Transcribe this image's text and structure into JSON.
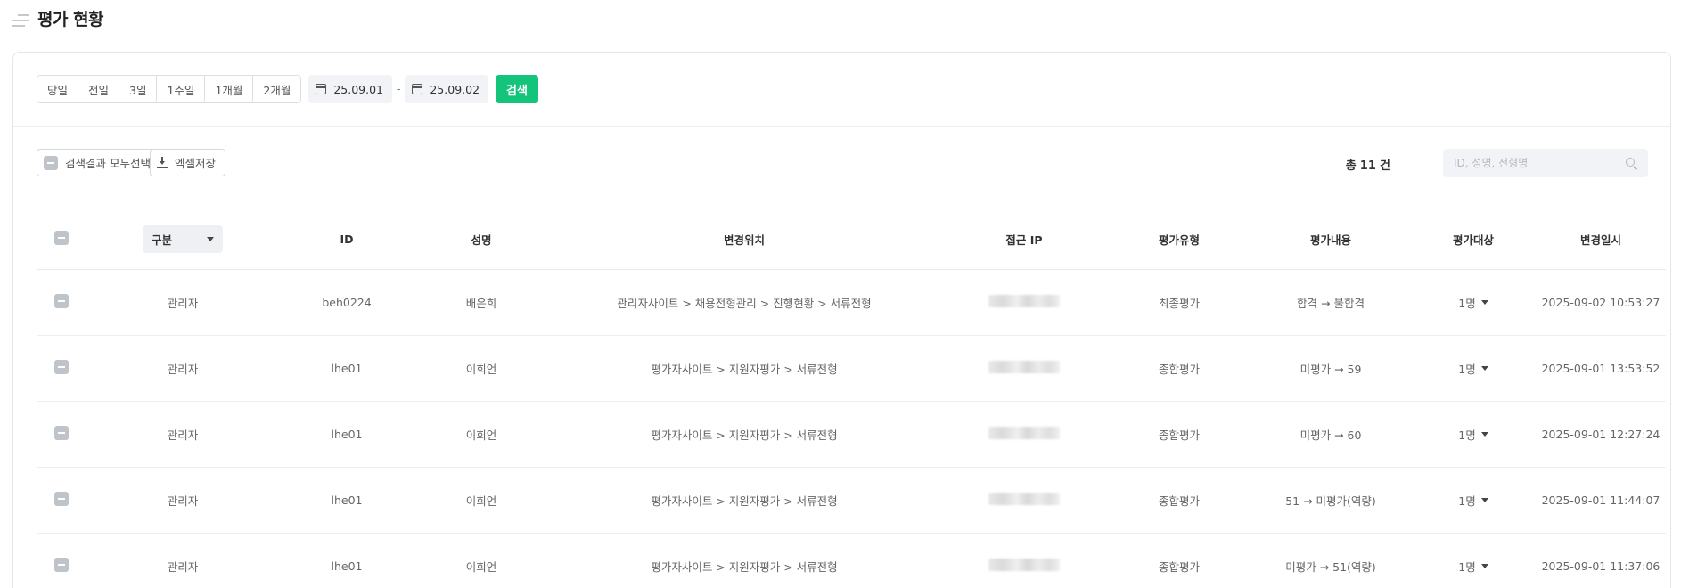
{
  "header": {
    "title": "평가 현황"
  },
  "filters": {
    "periods": [
      "당일",
      "전일",
      "3일",
      "1주일",
      "1개월",
      "2개월"
    ],
    "date_from": "25.09.01",
    "date_separator": "-",
    "date_to": "25.09.02",
    "search_label": "검색"
  },
  "toolbar": {
    "select_all_label": "검색결과 모두선택",
    "excel_label": "엑셀저장",
    "total_prefix": "총",
    "total_count": "11",
    "total_suffix": "건",
    "search_placeholder": "ID, 성명, 전형명"
  },
  "table": {
    "headers": {
      "type": "구분",
      "id": "ID",
      "name": "성명",
      "location": "변경위치",
      "ip": "접근 IP",
      "eval_type": "평가유형",
      "eval_content": "평가내용",
      "eval_target": "평가대상",
      "changed_at": "변경일시"
    },
    "rows": [
      {
        "type": "관리자",
        "id": "beh0224",
        "name": "배은희",
        "location": "관리자사이트 > 채용전형관리 > 진행현황 > 서류전형",
        "eval_type": "최종평가",
        "eval_content": "합격 → 불합격",
        "eval_target": "1명",
        "changed_at": "2025-09-02 10:53:27"
      },
      {
        "type": "관리자",
        "id": "lhe01",
        "name": "이희언",
        "location": "평가자사이트 > 지원자평가 > 서류전형",
        "eval_type": "종합평가",
        "eval_content": "미평가 → 59",
        "eval_target": "1명",
        "changed_at": "2025-09-01 13:53:52"
      },
      {
        "type": "관리자",
        "id": "lhe01",
        "name": "이희언",
        "location": "평가자사이트 > 지원자평가 > 서류전형",
        "eval_type": "종합평가",
        "eval_content": "미평가 → 60",
        "eval_target": "1명",
        "changed_at": "2025-09-01 12:27:24"
      },
      {
        "type": "관리자",
        "id": "lhe01",
        "name": "이희언",
        "location": "평가자사이트 > 지원자평가 > 서류전형",
        "eval_type": "종합평가",
        "eval_content": "51 → 미평가(역량)",
        "eval_target": "1명",
        "changed_at": "2025-09-01 11:44:07"
      },
      {
        "type": "관리자",
        "id": "lhe01",
        "name": "이희언",
        "location": "평가자사이트 > 지원자평가 > 서류전형",
        "eval_type": "종합평가",
        "eval_content": "미평가 → 51(역량)",
        "eval_target": "1명",
        "changed_at": "2025-09-01 11:37:06"
      }
    ]
  },
  "colors": {
    "accent": "#14c47a",
    "checkbox": "#bfc3ca"
  }
}
